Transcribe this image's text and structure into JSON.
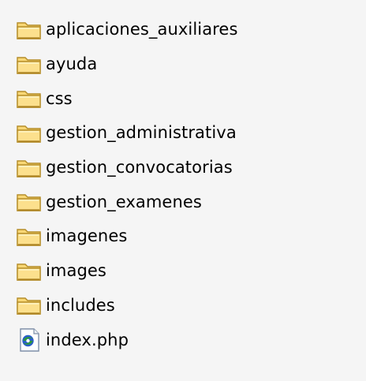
{
  "colors": {
    "background": "#f5f5f5",
    "text": "#000000",
    "folder_fill": "#f8d775",
    "folder_dark": "#c8a030",
    "folder_light": "#fff2b8",
    "php_green": "#2e9a3a",
    "php_blue": "#2b5fc8"
  },
  "items": [
    {
      "name": "aplicaciones_auxiliares",
      "icon": "folder-icon"
    },
    {
      "name": "ayuda",
      "icon": "folder-icon"
    },
    {
      "name": "css",
      "icon": "folder-icon"
    },
    {
      "name": "gestion_administrativa",
      "icon": "folder-icon"
    },
    {
      "name": "gestion_convocatorias",
      "icon": "folder-icon"
    },
    {
      "name": "gestion_examenes",
      "icon": "folder-icon"
    },
    {
      "name": "imagenes",
      "icon": "folder-icon"
    },
    {
      "name": "images",
      "icon": "folder-icon"
    },
    {
      "name": "includes",
      "icon": "folder-icon"
    },
    {
      "name": "index.php",
      "icon": "php-file-icon"
    }
  ]
}
